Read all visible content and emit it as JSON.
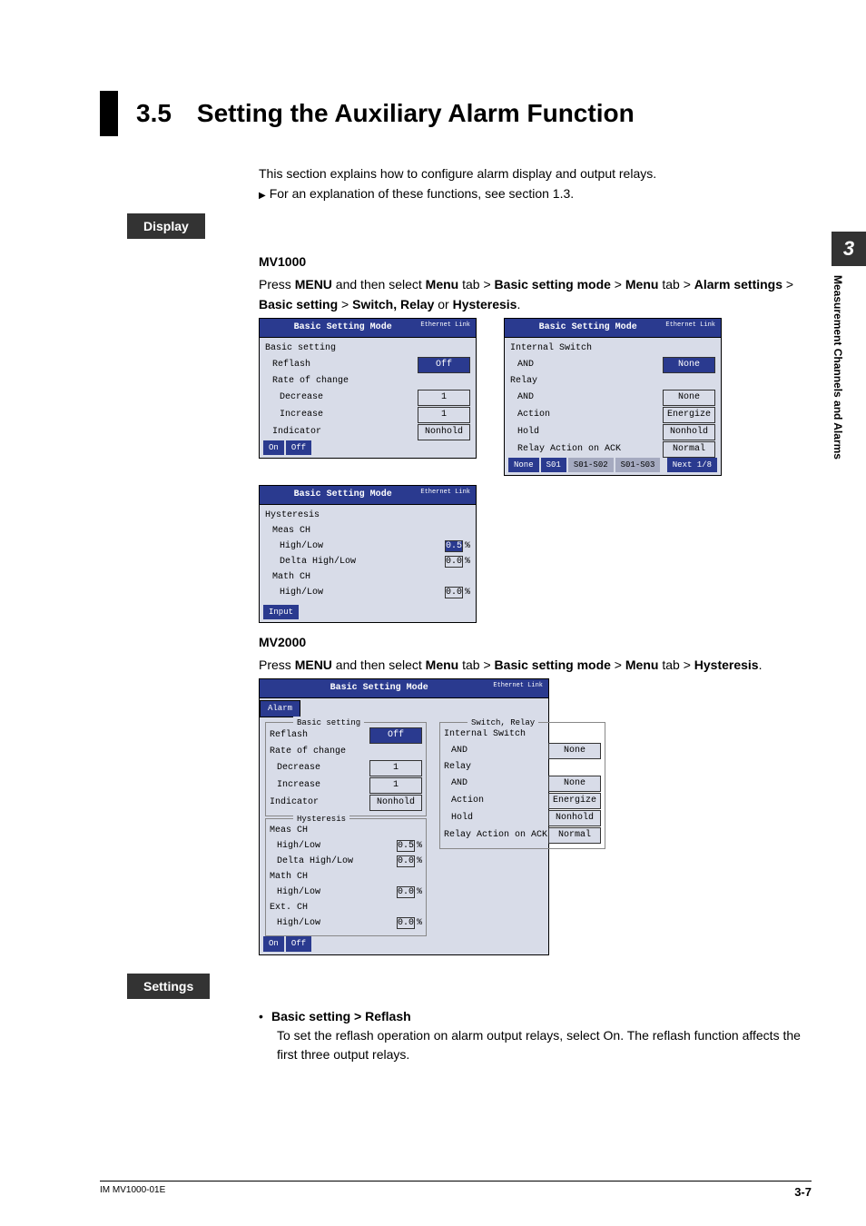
{
  "sideTab": {
    "number": "3",
    "label": "Measurement Channels and Alarms"
  },
  "title": "3.5 Setting the Auxiliary Alarm Function",
  "intro1": "This section explains how to configure alarm display and output relays.",
  "intro2": "For an explanation of these functions, see section 1.3.",
  "displayTab": "Display",
  "mv1000": {
    "header": "MV1000",
    "instr_pre": "Press ",
    "instr_menu": "MENU",
    "instr_mid1": " and then select ",
    "instr_b1": "Menu",
    "instr_t1": " tab > ",
    "instr_b2": "Basic setting mode",
    "instr_t2": " > ",
    "instr_b3": "Menu",
    "instr_t3": " tab > ",
    "instr_b4": "Alarm settings",
    "instr_t4": " > ",
    "instr_b5": "Basic setting",
    "instr_t5": " > ",
    "instr_b6": "Switch, Relay",
    "instr_t6": " or ",
    "instr_b7": "Hysteresis",
    "instr_end": "."
  },
  "screenHdr": "Basic Setting Mode",
  "ethLink": "Ethernet Link",
  "scr1": {
    "groupTitle": "Basic setting",
    "reflash": "Reflash",
    "reflash_v": "Off",
    "rate": "Rate of change",
    "dec": "Decrease",
    "dec_v": "1",
    "inc": "Increase",
    "inc_v": "1",
    "ind": "Indicator",
    "ind_v": "Nonhold",
    "sk_on": "On",
    "sk_off": "Off"
  },
  "scr2": {
    "int": "Internal Switch",
    "and1": "AND",
    "and1_v": "None",
    "relay": "Relay",
    "and2": "AND",
    "and2_v": "None",
    "act": "Action",
    "act_v": "Energize",
    "hold": "Hold",
    "hold_v": "Nonhold",
    "rack": "Relay Action on ACK",
    "rack_v": "Normal",
    "sk_none": "None",
    "sk_s01": "S01",
    "sk_s12": "S01-S02",
    "sk_s13": "S01-S03",
    "sk_next": "Next 1/8"
  },
  "scr3": {
    "groupTitle": "Hysteresis",
    "meas": "Meas CH",
    "hl": "High/Low",
    "hl_v": "0.5",
    "dhl": "Delta High/Low",
    "dhl_v": "0.0",
    "math": "Math CH",
    "mhl": "High/Low",
    "mhl_v": "0.0",
    "unit": "%",
    "sk_input": "Input"
  },
  "mv2000": {
    "header": "MV2000",
    "instr_pre": "Press ",
    "instr_menu": "MENU",
    "instr_mid1": " and then select ",
    "instr_b1": "Menu",
    "instr_t1": " tab > ",
    "instr_b2": "Basic setting mode",
    "instr_t2": " > ",
    "instr_b3": "Menu",
    "instr_t3": " tab > ",
    "instr_b4": "Hysteresis",
    "instr_end": "."
  },
  "scr4": {
    "alarmTab": "Alarm",
    "bs_leg": "Basic setting",
    "reflash": "Reflash",
    "reflash_v": "Off",
    "rate": "Rate of change",
    "dec": "Decrease",
    "dec_v": "1",
    "inc": "Increase",
    "inc_v": "1",
    "ind": "Indicator",
    "ind_v": "Nonhold",
    "hy_leg": "Hysteresis",
    "meas": "Meas CH",
    "hl": "High/Low",
    "hl_v": "0.5",
    "dhl": "Delta High/Low",
    "dhl_v": "0.0",
    "math": "Math CH",
    "mhl": "High/Low",
    "mhl_v": "0.0",
    "ext": "Ext. CH",
    "ehl": "High/Low",
    "ehl_v": "0.0",
    "unit": "%",
    "sw_leg": "Switch, Relay",
    "int": "Internal Switch",
    "and1": "AND",
    "and1_v": "None",
    "relay": "Relay",
    "and2": "AND",
    "and2_v": "None",
    "act": "Action",
    "act_v": "Energize",
    "hold": "Hold",
    "hold_v": "Nonhold",
    "rack": "Relay Action on ACK",
    "rack_v": "Normal",
    "sk_on": "On",
    "sk_off": "Off"
  },
  "settingsTab": "Settings",
  "setting1_title": "Basic setting > Reflash",
  "setting1_body": "To set the reflash operation on alarm output relays, select On. The reflash function affects the first three output relays.",
  "footer_left": "IM MV1000-01E",
  "footer_right": "3-7"
}
